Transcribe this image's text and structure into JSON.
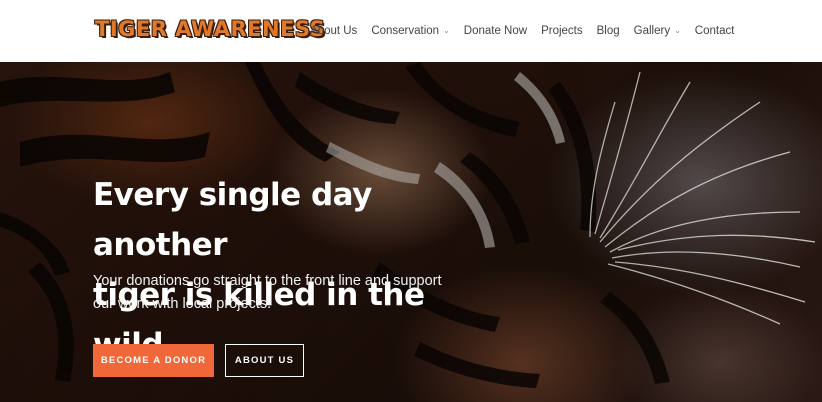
{
  "logo": {
    "text": "TIGER AWARENESS"
  },
  "nav": {
    "items": [
      {
        "label": "About Us",
        "dropdown": false
      },
      {
        "label": "Conservation",
        "dropdown": true
      },
      {
        "label": "Donate Now",
        "dropdown": false
      },
      {
        "label": "Projects",
        "dropdown": false
      },
      {
        "label": "Blog",
        "dropdown": false
      },
      {
        "label": "Gallery",
        "dropdown": true
      },
      {
        "label": "Contact",
        "dropdown": false
      }
    ]
  },
  "hero": {
    "headline_line1": "Every single day another",
    "headline_line2": "tiger is killed in the wild.",
    "subtext_line1": "Your donations go straight to the front line and support",
    "subtext_line2": "our work with local projects.",
    "primary_button": "BECOME A DONOR",
    "secondary_button": "ABOUT US",
    "image": "tiger-face-closeup"
  },
  "colors": {
    "accent": "#f0683a",
    "logo_fill": "#e07a2a",
    "nav_text": "#444444"
  }
}
